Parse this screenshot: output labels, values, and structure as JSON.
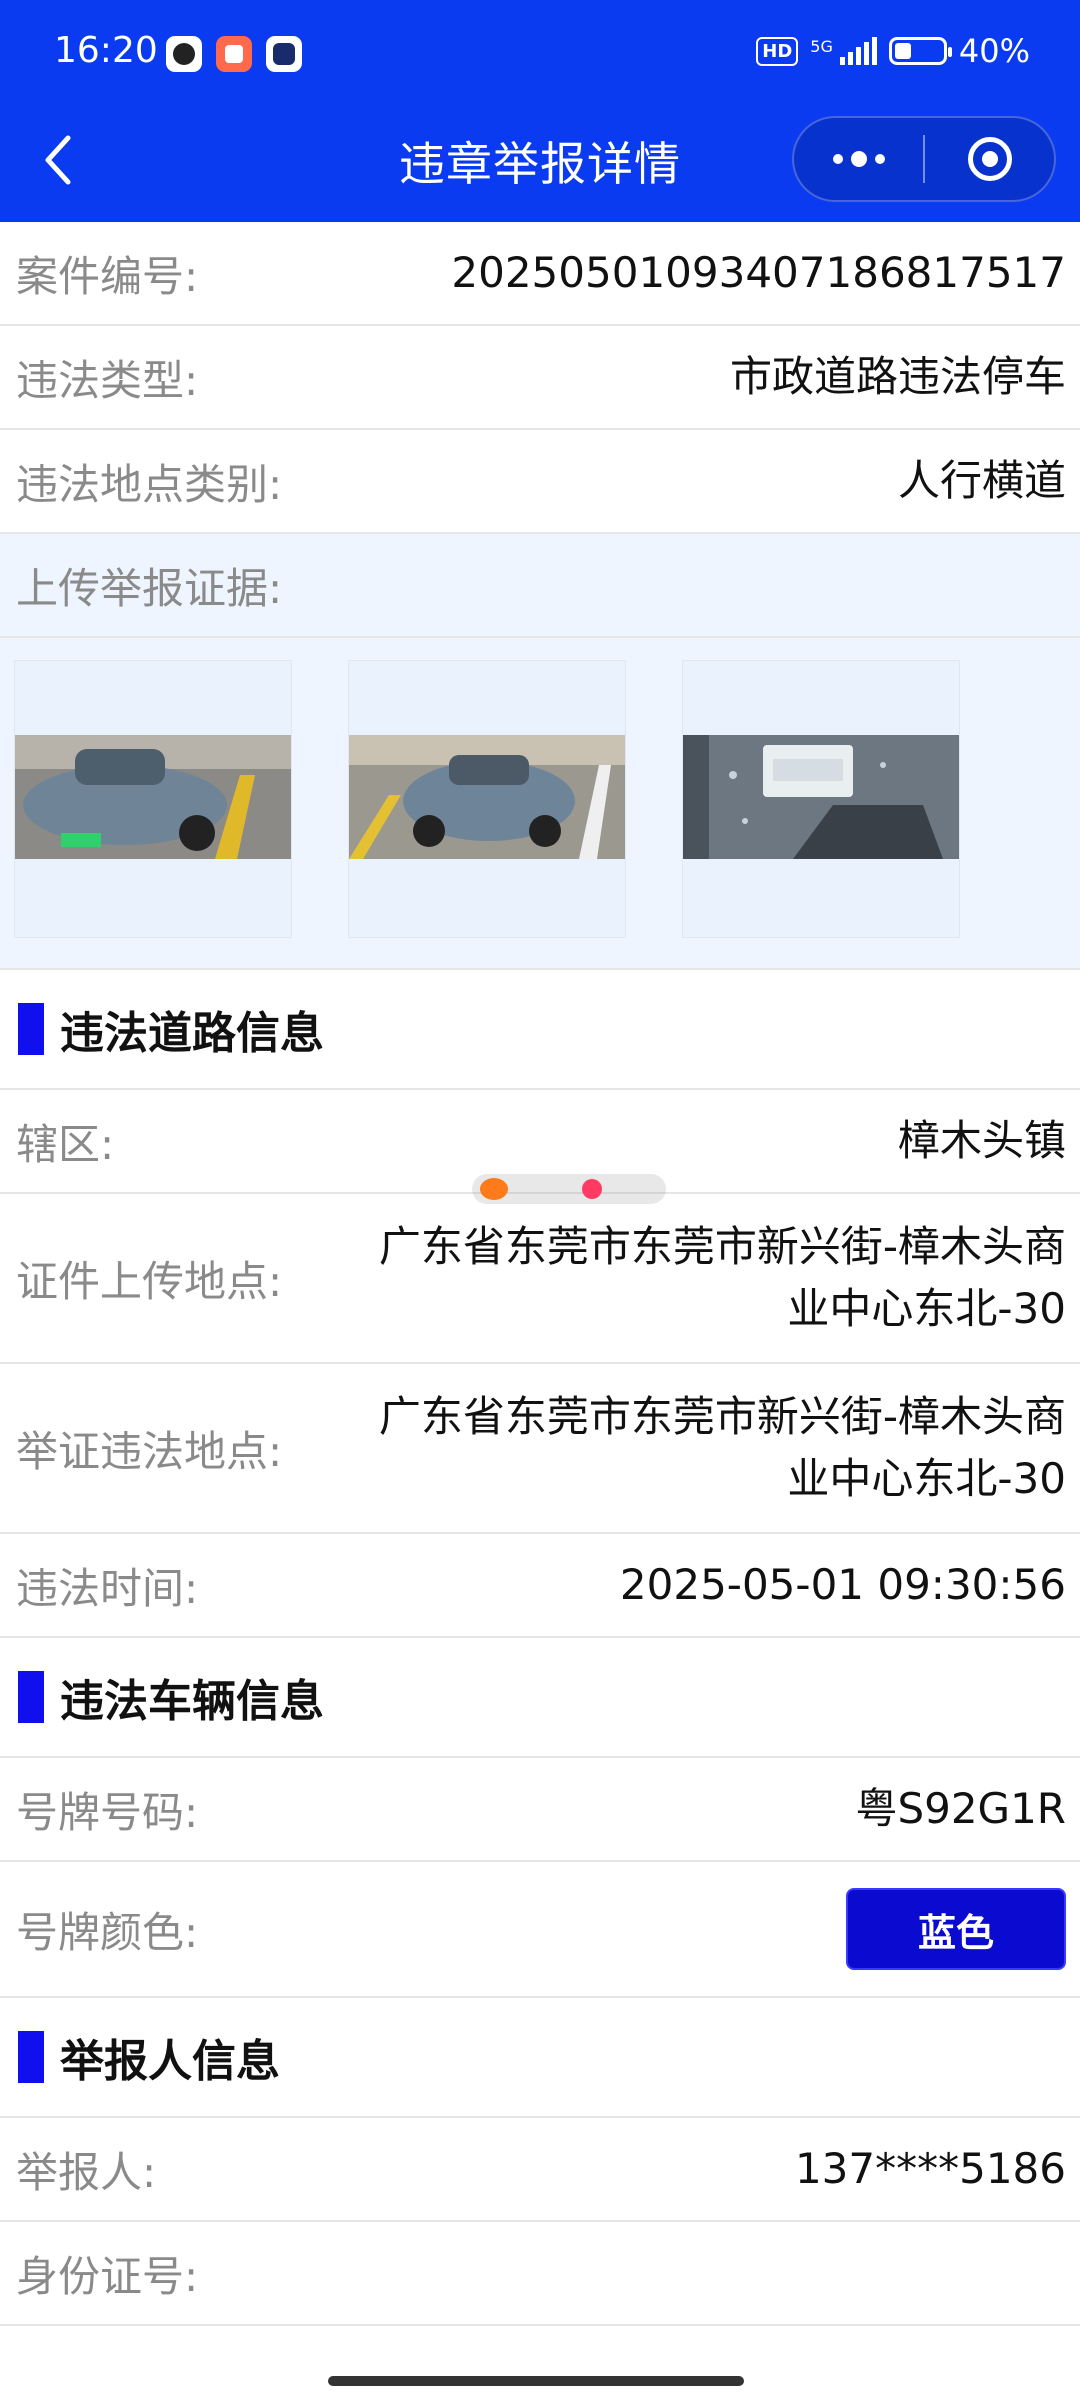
{
  "status_bar": {
    "time": "16:20",
    "network": "5G",
    "hd": "HD",
    "battery": "40%"
  },
  "header": {
    "title": "违章举报详情"
  },
  "rows_top": [
    {
      "label": "案件编号:",
      "value": "20250501093407186817517"
    },
    {
      "label": "违法类型:",
      "value": "市政道路违法停车"
    },
    {
      "label": "违法地点类别:",
      "value": "人行横道"
    }
  ],
  "evidence": {
    "label": "上传举报证据:"
  },
  "road_section": {
    "title": "违法道路信息",
    "rows": [
      {
        "label": "辖区:",
        "value": "樟木头镇"
      },
      {
        "label": "证件上传地点:",
        "value": "广东省东莞市东莞市新兴街-樟木头商业中心东北-30"
      },
      {
        "label": "举证违法地点:",
        "value": "广东省东莞市东莞市新兴街-樟木头商业中心东北-30"
      },
      {
        "label": "违法时间:",
        "value": "2025-05-01 09:30:56"
      }
    ]
  },
  "vehicle_section": {
    "title": "违法车辆信息",
    "plate_label": "号牌号码:",
    "plate_value": "粤S92G1R",
    "color_label": "号牌颜色:",
    "color_value": "蓝色"
  },
  "reporter_section": {
    "title": "举报人信息",
    "reporter_label": "举报人:",
    "reporter_value": "137****5186",
    "id_label": "身份证号:",
    "id_value": ""
  },
  "colors": {
    "header_bg": "#0a3bf0",
    "section_marker": "#1010ee",
    "plate_chip": "#0a0ad0",
    "tint": "#eef5ff"
  }
}
